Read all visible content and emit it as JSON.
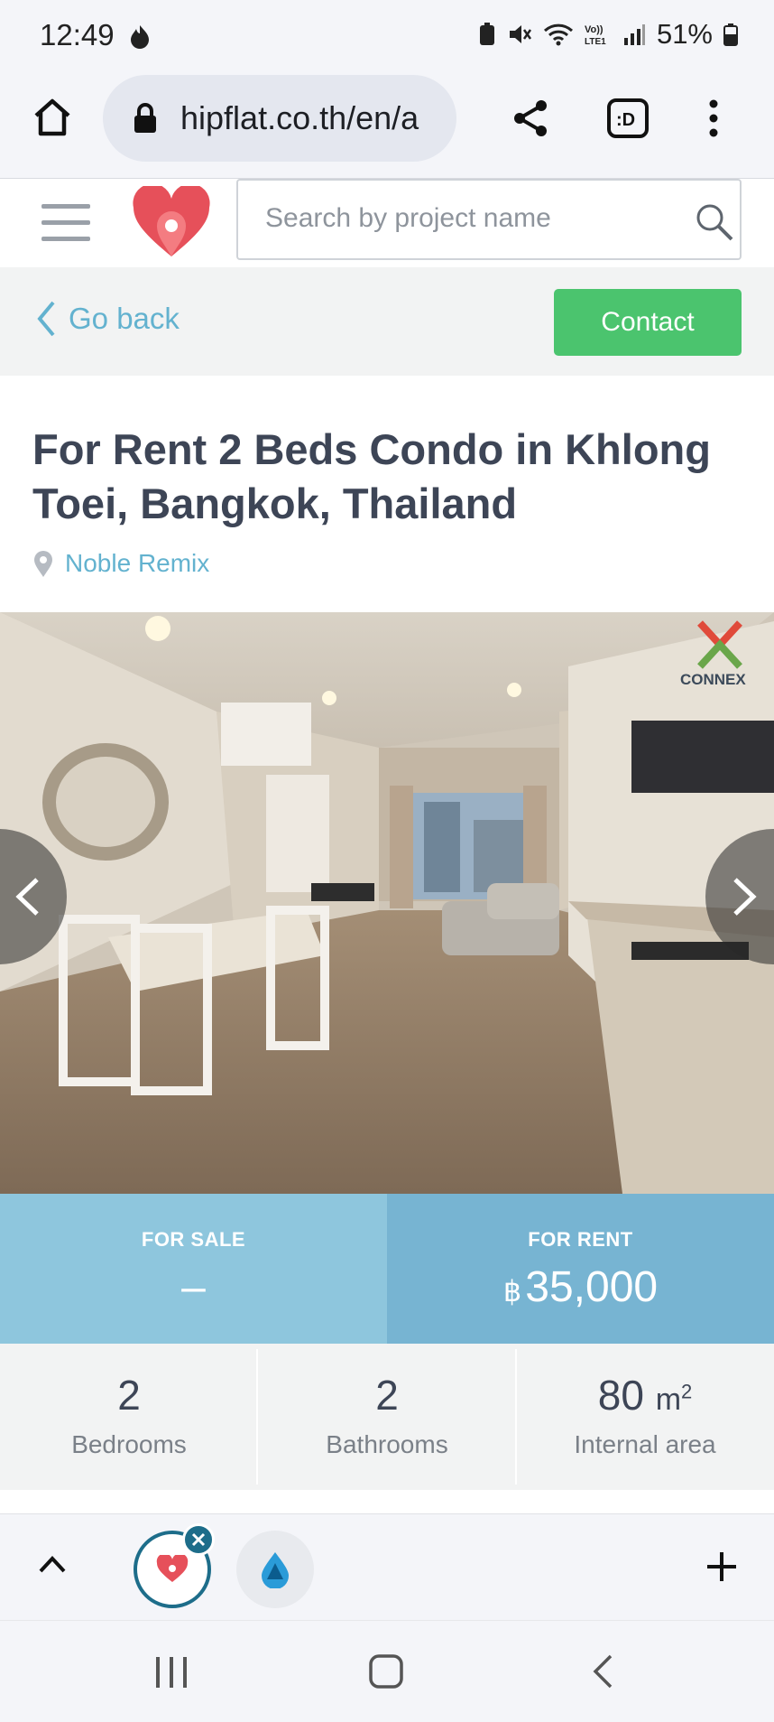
{
  "status_bar": {
    "time": "12:49",
    "battery": "51%"
  },
  "browser": {
    "url": "hipflat.co.th/en/a"
  },
  "header": {
    "search_placeholder": "Search by project name"
  },
  "action_bar": {
    "back_label": "Go back",
    "contact_label": "Contact"
  },
  "listing": {
    "title": "For Rent 2 Beds Condo in Khlong Toei, Bangkok, Thailand",
    "project": "Noble Remix",
    "watermark": "CONNEX"
  },
  "prices": {
    "sale_label": "FOR SALE",
    "sale_value": "–",
    "rent_label": "FOR RENT",
    "currency": "฿",
    "rent_value": "35,000"
  },
  "stats": {
    "bedrooms_value": "2",
    "bedrooms_label": "Bedrooms",
    "bathrooms_value": "2",
    "bathrooms_label": "Bathrooms",
    "area_value": "80",
    "area_unit": "m",
    "area_exp": "2",
    "area_label": "Internal area"
  },
  "colors": {
    "accent": "#63b2cf",
    "contact_green": "#4bc46e",
    "sale_panel": "#8ec6dd",
    "rent_panel": "#77b4d2",
    "brand_red": "#e6505a"
  },
  "icons": [
    "home-icon",
    "lock-icon",
    "share-icon",
    "tab-switcher-icon",
    "more-icon",
    "hamburger-icon",
    "hipflat-logo-icon",
    "search-icon",
    "chevron-left-icon",
    "location-pin-icon",
    "carousel-prev-icon",
    "carousel-next-icon",
    "chevron-up-icon",
    "close-icon",
    "plus-icon"
  ]
}
